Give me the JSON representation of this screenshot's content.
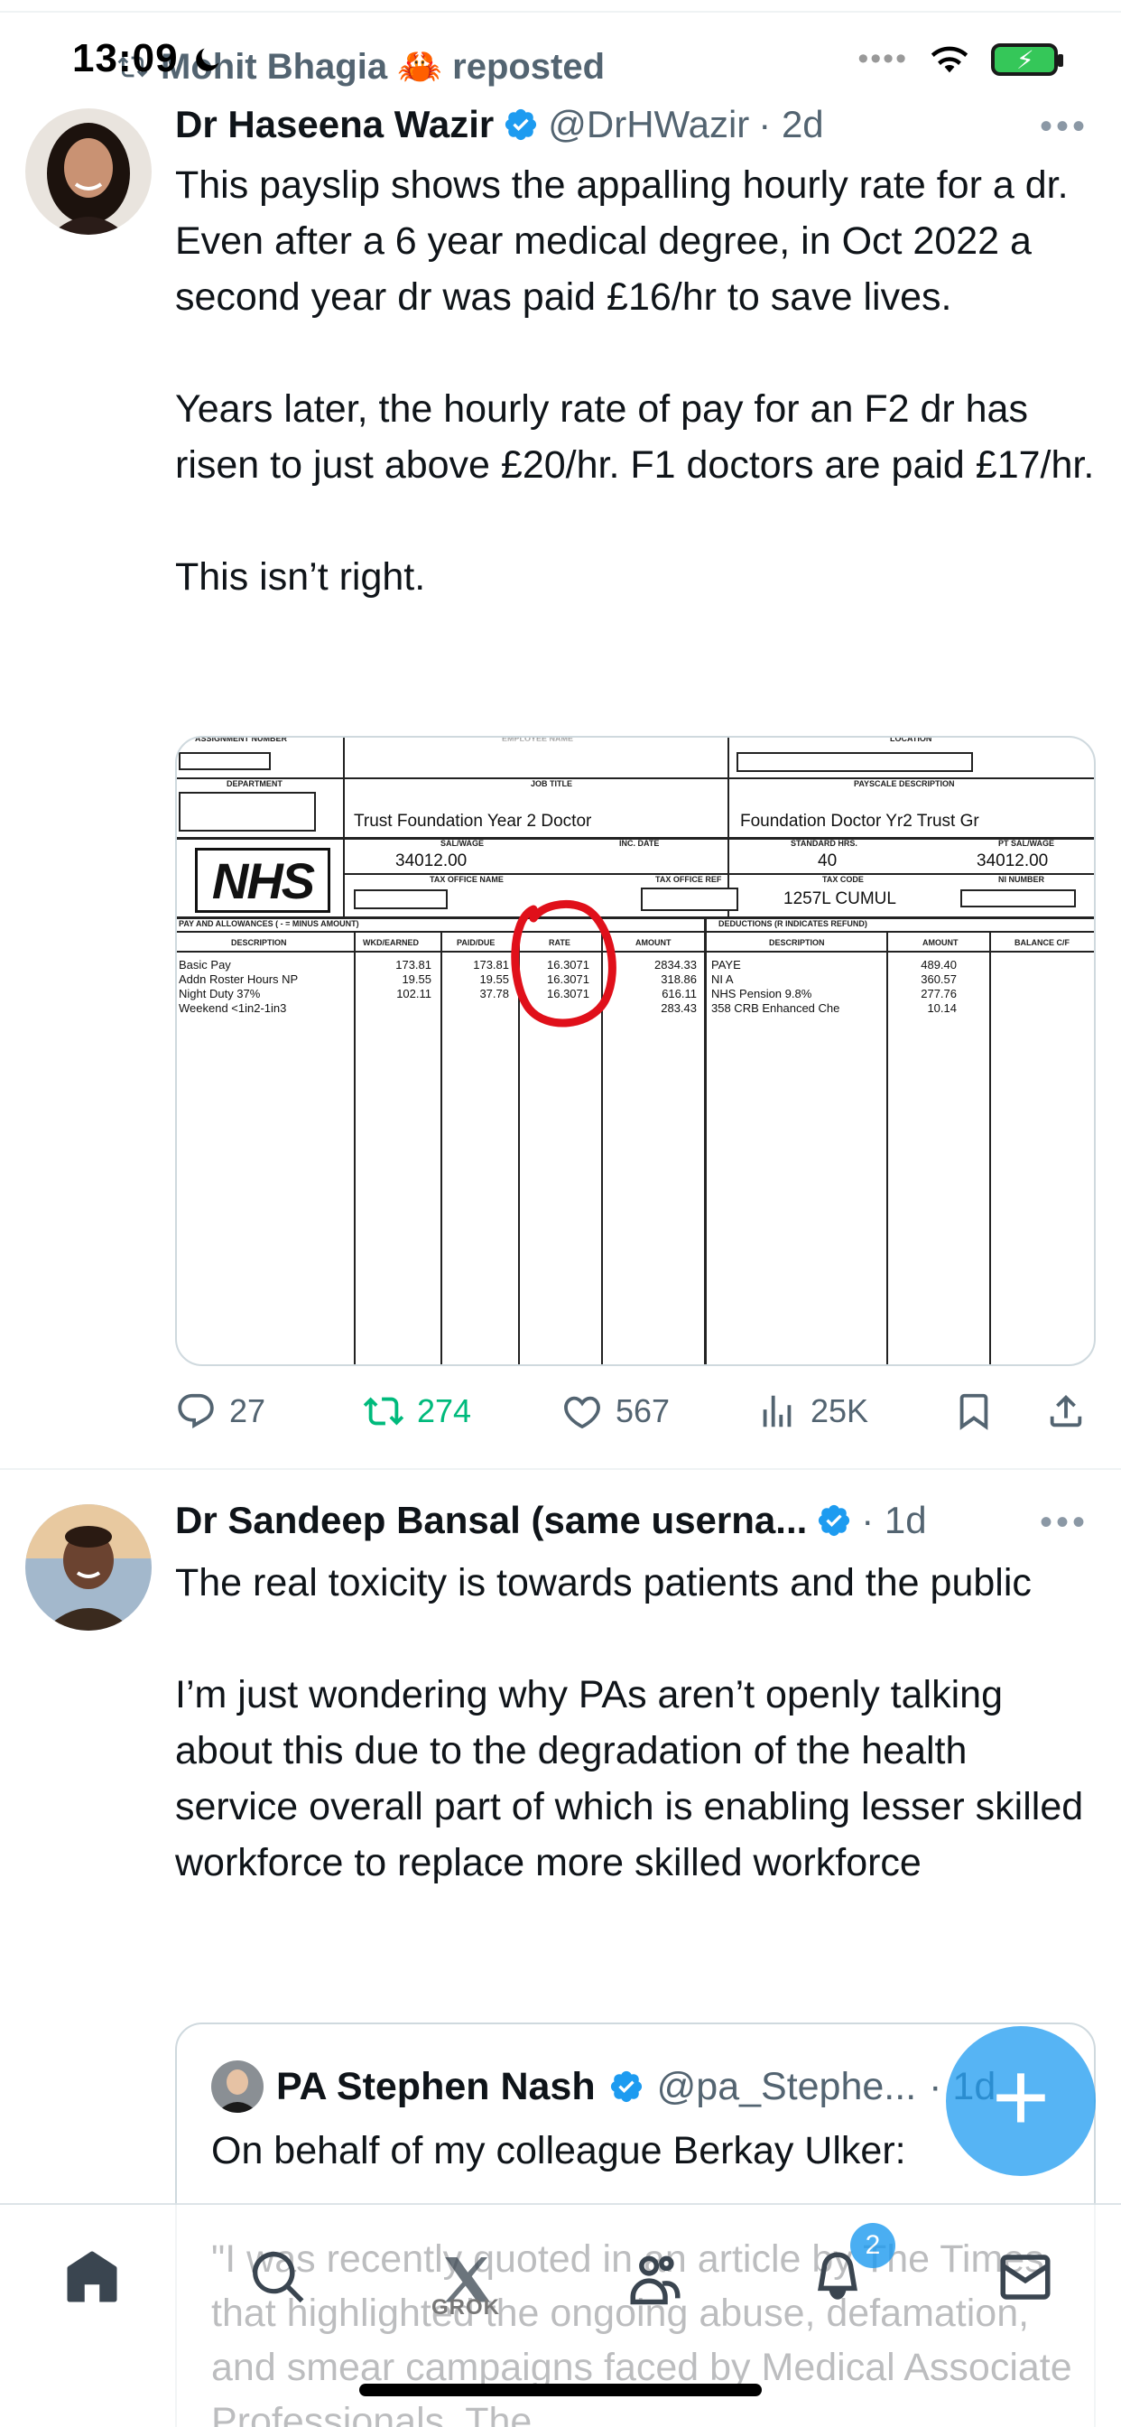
{
  "status_bar": {
    "time": "13:09"
  },
  "repost": {
    "label": "Mohit Bhagia 🦀 reposted"
  },
  "tweet1": {
    "display_name": "Dr Haseena Wazir",
    "handle": "@DrHWazir",
    "time": "· 2d",
    "more": "•••",
    "text": "This payslip shows the appalling hourly rate for a dr. Even after a 6 year medical degree, in Oct 2022 a second year dr was paid £16/hr to save lives.\n\nYears later, the hourly rate of pay for an F2 dr has risen to just above £20/hr. F1 doctors are paid £17/hr.\n\nThis isn’t right.",
    "actions": {
      "replies": "27",
      "reposts": "274",
      "likes": "567",
      "views": "25K"
    }
  },
  "payslip": {
    "headers": {
      "assignment_number": "ASSIGNMENT NUMBER",
      "employee_name": "EMPLOYEE NAME",
      "location": "LOCATION",
      "department": "DEPARTMENT",
      "job_title": "JOB TITLE",
      "payscale_description": "PAYSCALE DESCRIPTION",
      "salwage": "SAL/WAGE",
      "inc_date": "INC. DATE",
      "standard_hrs": "STANDARD HRS.",
      "pt_salwage": "PT SAL/WAGE",
      "tax_office_name": "TAX OFFICE NAME",
      "tax_office_ref": "TAX OFFICE REF",
      "tax_code": "TAX CODE",
      "ni_number": "NI NUMBER",
      "pay_allowances": "PAY AND ALLOWANCES ( - = MINUS AMOUNT)",
      "deductions": "DEDUCTIONS (R INDICATES REFUND)",
      "col_description": "DESCRIPTION",
      "col_wkd": "WKD/EARNED",
      "col_paid": "PAID/DUE",
      "col_rate": "RATE",
      "col_amount": "AMOUNT",
      "col_ded_description": "DESCRIPTION",
      "col_ded_amount": "AMOUNT",
      "col_balance": "BALANCE C/F"
    },
    "logo": "NHS",
    "job_title": "Trust Foundation Year 2 Doctor",
    "payscale_description": "Foundation Doctor Yr2 Trust Gr",
    "salwage": "34012.00",
    "standard_hrs": "40",
    "pt_salwage": "34012.00",
    "tax_code": "1257L CUMUL",
    "pay_rows": {
      "descriptions": "Basic Pay\nAddn Roster Hours NP\nNight Duty 37%\nWeekend <1in2-1in3",
      "wkd": "173.81\n19.55\n102.11",
      "paid": "173.81\n19.55\n37.78",
      "rate": "16.3071\n16.3071\n16.3071",
      "amount": "2834.33\n318.86\n616.11\n283.43"
    },
    "deduction_rows": {
      "descriptions": "PAYE\nNI A\nNHS Pension 9.8%\n358 CRB Enhanced Che",
      "amount": "489.40\n360.57\n277.76\n10.14"
    }
  },
  "tweet2": {
    "display_name": "Dr Sandeep Bansal (same userna...",
    "time": "· 1d",
    "more": "•••",
    "text": "The real toxicity is towards patients and the public\n\nI’m just wondering why PAs aren’t openly talking about this due to the degradation of the health service overall part of which is enabling lesser skilled workforce to replace more skilled workforce"
  },
  "quote": {
    "display_name": "PA Stephen Nash",
    "handle": "@pa_Stephe...",
    "time": "· 1d",
    "text": "On behalf of my colleague Berkay Ulker:\n\n\"I was recently quoted in an article by The Times that highlighted the ongoing abuse, defamation, and smear campaigns faced by Medical Associate Professionals. The"
  },
  "nav": {
    "grok_label": "GROK",
    "notification_count": "2"
  },
  "colors": {
    "accent": "#1d9bf0",
    "repost_green": "#00ba7c",
    "muted": "#536471",
    "circle_red": "#e0101a"
  }
}
